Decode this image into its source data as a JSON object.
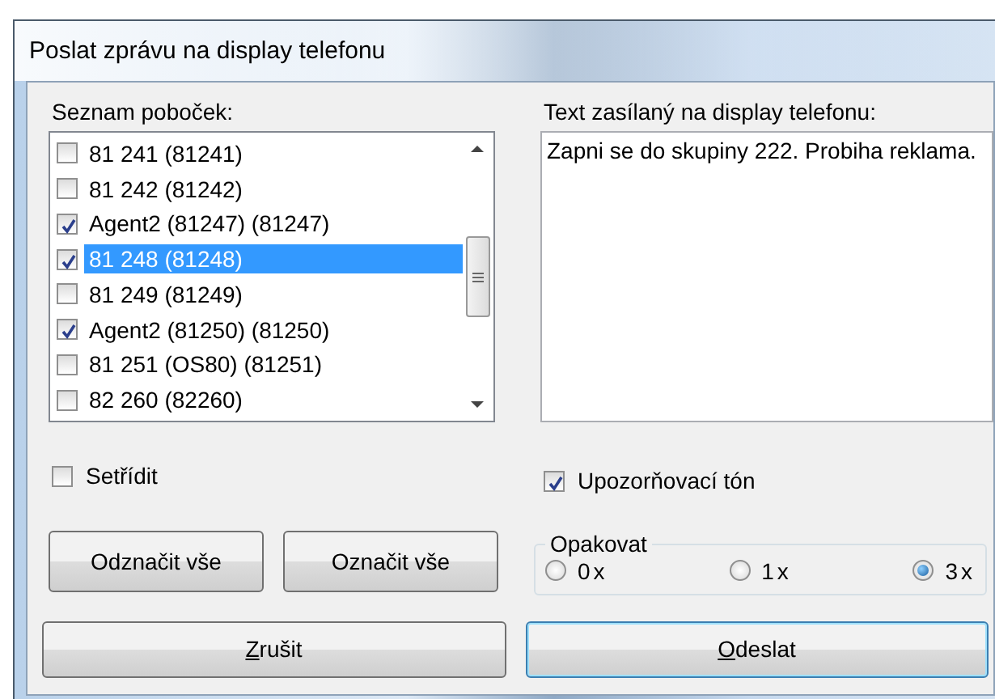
{
  "window": {
    "title": "Poslat zprávu na display telefonu"
  },
  "extensions": {
    "label": "Seznam poboček:",
    "items": [
      {
        "text": "81 241 (81241)",
        "checked": false,
        "selected": false
      },
      {
        "text": "81 242 (81242)",
        "checked": false,
        "selected": false
      },
      {
        "text": "Agent2 (81247) (81247)",
        "checked": true,
        "selected": false
      },
      {
        "text": "81 248 (81248)",
        "checked": true,
        "selected": true
      },
      {
        "text": "81 249 (81249)",
        "checked": false,
        "selected": false
      },
      {
        "text": "Agent2 (81250) (81250)",
        "checked": true,
        "selected": false
      },
      {
        "text": "81 251 (OS80) (81251)",
        "checked": false,
        "selected": false
      },
      {
        "text": "82 260 (82260)",
        "checked": false,
        "selected": false
      }
    ]
  },
  "message": {
    "label": "Text zasílaný na display telefonu:",
    "value": "Zapni se do skupiny 222. Probiha reklama."
  },
  "sort": {
    "label": "Setřídit",
    "checked": false
  },
  "alert_tone": {
    "label": "Upozorňovací tón",
    "checked": true
  },
  "select_buttons": [
    "Odznačit vše",
    "Označit vše"
  ],
  "repeat": {
    "label": "Opakovat",
    "options": [
      {
        "label": "0x",
        "selected": false
      },
      {
        "label": "1x",
        "selected": false
      },
      {
        "label": "3x",
        "selected": true
      }
    ]
  },
  "buttons": [
    {
      "label": "Zrušit",
      "default": false
    },
    {
      "label": "Odeslat",
      "default": true
    }
  ]
}
